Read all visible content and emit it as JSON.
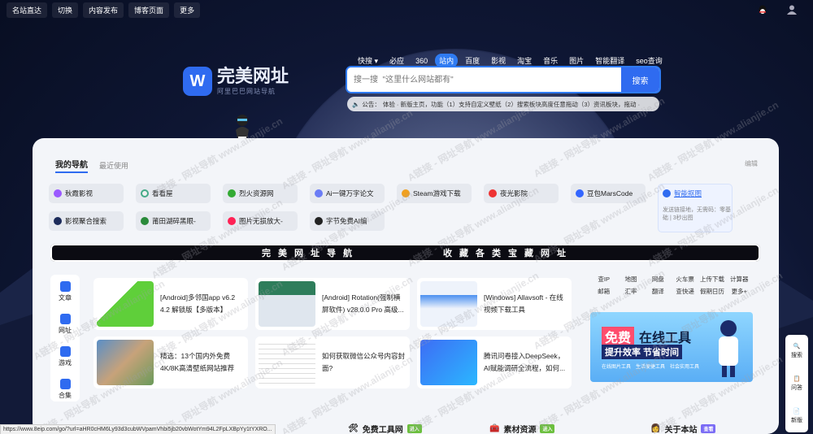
{
  "topbar": {
    "items": [
      "名站直达",
      "切换",
      "内容发布",
      "博客页面",
      "更多"
    ]
  },
  "logo": {
    "mark": "W",
    "title": "完美网址",
    "subtitle": "阿里巴巴网站导航"
  },
  "engines": {
    "items": [
      "快搜",
      "必应",
      "360",
      "站内",
      "百度",
      "影视",
      "淘宝",
      "音乐",
      "图片",
      "智能翻译",
      "seo查询"
    ],
    "active": "站内"
  },
  "search": {
    "placeholder": "搜一搜  \"这里什么网站都有\"",
    "button": "搜索"
  },
  "notice": {
    "label": "公告：",
    "text": "体验 · 新版主页，功能（1）支持自定义壁纸（2）搜索板块高度任意拖动（3）资讯板块，拖动 ·"
  },
  "panel": {
    "tabs": [
      "我的导航",
      "最近使用"
    ],
    "edit": "编辑",
    "nav_row1": [
      "秋霞影视",
      "看看屋",
      "烈火资源网",
      "Ai一键万字论文",
      "Steam游戏下载",
      "夜光影院",
      "豆包MarsCode",
      "智能抠图"
    ],
    "nav_row2": [
      "影视聚合搜索",
      "莆田湖碎黑眼-",
      "图片无损放大-",
      "字节免费AI编"
    ],
    "tip": "发送链接地，无需码：零基础 | 3秒出图",
    "banner_left": "完美网址导航",
    "banner_right": "收藏各类宝藏网址",
    "sidenav": [
      "文章",
      "网址",
      "游戏",
      "合集"
    ],
    "posts": [
      "[Android]多邻国app v6.2 4.2 解锁版【多版本】",
      "[Android] Rotation(强制横屏软件) v28.0.0 Pro 高级...",
      "[Windows] Allavsoft - 在线视频下载工具",
      "精选：13个国内外免费4K/8K高清壁纸网站推荐",
      "如何获取微信公众号内容封面?",
      "腾讯问卷接入DeepSeek，AI赋能调研全流程，如何..."
    ],
    "tool_links": [
      "查IP",
      "地图",
      "网盘",
      "火车票",
      "上传下载",
      "计算器",
      "邮箱",
      "汇率",
      "翻译",
      "查快递",
      "假期日历",
      "更多+"
    ],
    "promo": {
      "line1": "免费",
      "line1b": "在线工具",
      "line2": "提升效率 节省时间",
      "chips": [
        "在线图片工具",
        "生活便捷工具",
        "社会实用工具"
      ]
    },
    "bottom": [
      {
        "label": "免费工具网",
        "badge": "进入",
        "badge_color": "#6bbf3d"
      },
      {
        "label": "素材资源",
        "badge": "进入",
        "badge_color": "#6bbf3d"
      },
      {
        "label": "关于本站",
        "badge": "查看",
        "badge_color": "#7b6cf5"
      }
    ]
  },
  "floatbar": [
    "搜索",
    "问答",
    "新版"
  ],
  "status_url": "https://www.8eip.com/go/?url=aHR0cHM6Ly93d3cubWVpamVhbi5jb20vbWotYm94L2FpLXBpYy1tYXRO...",
  "watermark": "A链接 - 网址导航  www.alianjie.cn"
}
